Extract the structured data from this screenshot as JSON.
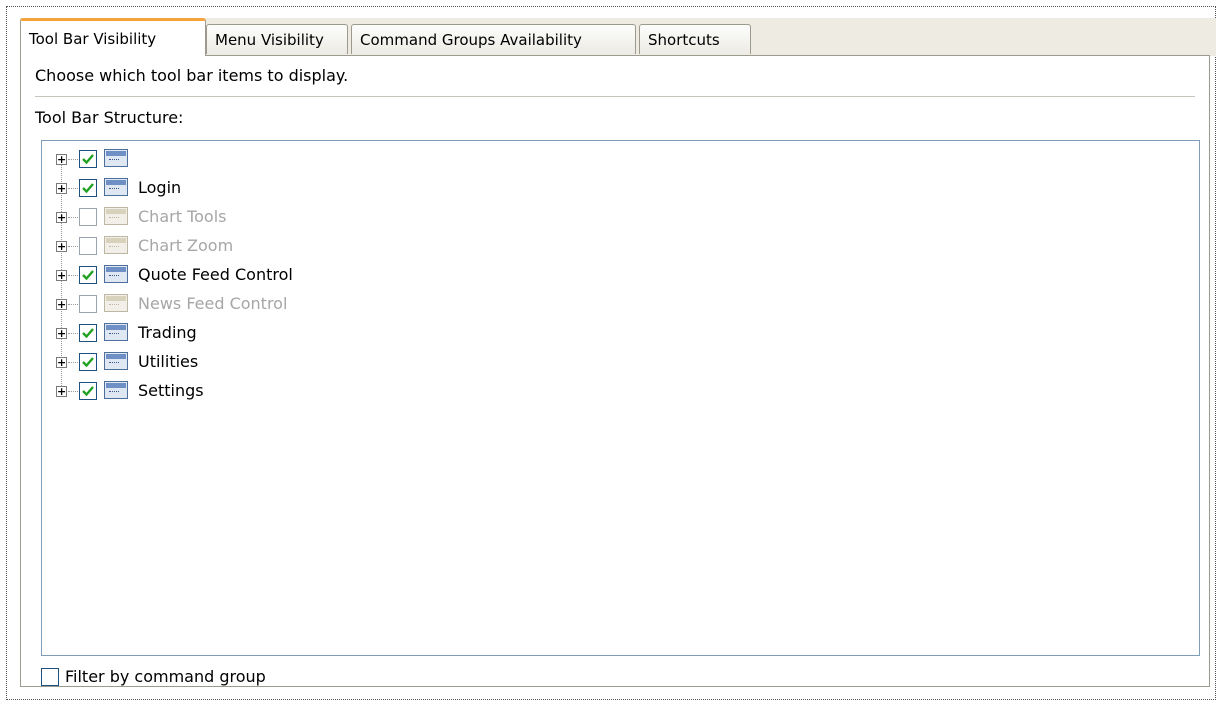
{
  "tabs": [
    {
      "label": "Tool Bar Visibility",
      "active": true
    },
    {
      "label": "Menu Visibility",
      "active": false
    },
    {
      "label": "Command Groups Availability",
      "active": false
    },
    {
      "label": "Shortcuts",
      "active": false
    }
  ],
  "description": "Choose which tool bar items to display.",
  "structure_label": "Tool Bar Structure:",
  "tree": [
    {
      "label": "",
      "checked": true,
      "enabled": true
    },
    {
      "label": "Login",
      "checked": true,
      "enabled": true
    },
    {
      "label": "Chart Tools",
      "checked": false,
      "enabled": false
    },
    {
      "label": "Chart Zoom",
      "checked": false,
      "enabled": false
    },
    {
      "label": "Quote Feed Control",
      "checked": true,
      "enabled": true
    },
    {
      "label": "News Feed Control",
      "checked": false,
      "enabled": false
    },
    {
      "label": "Trading",
      "checked": true,
      "enabled": true
    },
    {
      "label": "Utilities",
      "checked": true,
      "enabled": true
    },
    {
      "label": "Settings",
      "checked": true,
      "enabled": true
    }
  ],
  "filter": {
    "label": "Filter by command group",
    "checked": false
  },
  "colors": {
    "active_tab_accent": "#f5a33a",
    "check": "#21a121",
    "tree_border": "#7f9db9"
  }
}
